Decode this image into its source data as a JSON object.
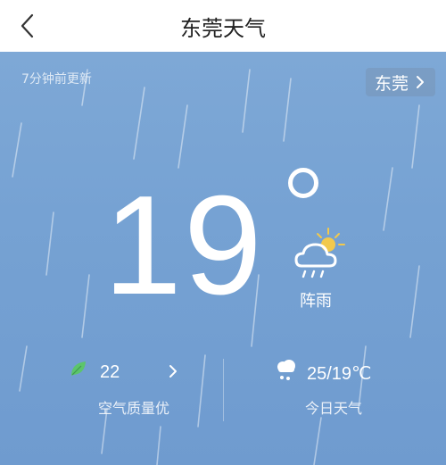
{
  "header": {
    "title": "东莞天气",
    "back_icon": "chevron-left-icon"
  },
  "weather": {
    "updated": "7分钟前更新",
    "city": "东莞",
    "temperature": "19",
    "condition": "阵雨",
    "condition_icon": "cloud-sun-rain-icon",
    "air_quality": {
      "value": "22",
      "label": "空气质量优",
      "icon": "leaf-icon"
    },
    "today": {
      "range": "25/19℃",
      "label": "今日天气",
      "icon": "cloud-rain-icon"
    }
  },
  "colors": {
    "sky": "#76a2d3",
    "leaf": "#5cc56b",
    "sun": "#f2c94c"
  }
}
